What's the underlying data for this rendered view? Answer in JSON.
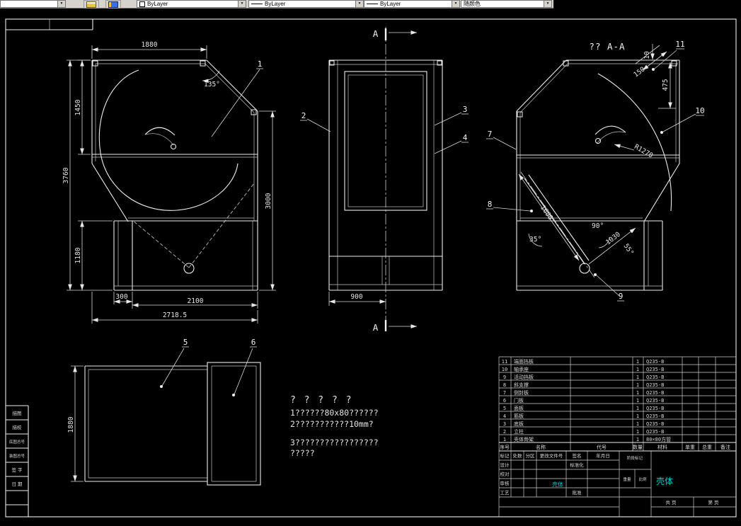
{
  "colors": {
    "background": "#000000",
    "line": "#ececec",
    "accent_cyan": "#00c8c8",
    "toolbar_bg": "#d6d3ce"
  },
  "toolbar": {
    "bylayer1": "ByLayer",
    "bylayer2": "ByLayer",
    "bylayer3": "ByLayer",
    "color_combo": "随颜色"
  },
  "sheet": {
    "left_strip": [
      "描图",
      "描校",
      "底图总号",
      "装图总号",
      "签 字",
      "日 期"
    ]
  },
  "plan": {
    "dim_top": "1880",
    "dim_h1": "1450",
    "dim_h_total": "3760",
    "dim_h2": "1180",
    "dim_b1": "300",
    "dim_b2": "2100",
    "dim_b3": "2718.5",
    "angle": "135°",
    "dim_right": "3000",
    "leader1": "1"
  },
  "front": {
    "dim_bottom": "900",
    "section_a_top": "A",
    "section_a_bottom": "A",
    "leader2": "2",
    "leader3": "3",
    "leader4": "4"
  },
  "section": {
    "title": "?? A-A",
    "dim150": "150",
    "dim10": "10",
    "dim475": "475",
    "radius": "R1270",
    "dim1600": "1600",
    "angle90": "90°",
    "dim1030": "1030",
    "angle35": "35°",
    "angle55": "55°",
    "leader7": "7",
    "leader8": "8",
    "leader9": "9",
    "leader10": "10",
    "leader11": "11"
  },
  "bottom_view": {
    "dim_left": "1880",
    "leader5": "5",
    "leader6": "6"
  },
  "notes": {
    "title": "? ? ? ? ?",
    "line1": "1??????80x80??????",
    "line2": "2???????????10mm?",
    "line3": "3?????????????????",
    "line4": "?????"
  },
  "bom": {
    "header": {
      "c1": "序号",
      "c2": "名称",
      "c3": "代号",
      "c4": "数量",
      "c5": "材料",
      "c6": "单重",
      "c7": "总重",
      "c8": "备注"
    },
    "rows": [
      {
        "no": "11",
        "name": "端面挡板",
        "qty": "1",
        "mat": "Q235-B"
      },
      {
        "no": "10",
        "name": "轴承座",
        "qty": "1",
        "mat": "Q235-B"
      },
      {
        "no": "9",
        "name": "活动挡板",
        "qty": "1",
        "mat": "Q235-B"
      },
      {
        "no": "8",
        "name": "斜支撑",
        "qty": "1",
        "mat": "Q235-B"
      },
      {
        "no": "7",
        "name": "侧封板",
        "qty": "1",
        "mat": "Q235-B"
      },
      {
        "no": "6",
        "name": "门板",
        "qty": "1",
        "mat": "Q235-B"
      },
      {
        "no": "5",
        "name": "面板",
        "qty": "1",
        "mat": "Q235-B"
      },
      {
        "no": "4",
        "name": "筋板",
        "qty": "1",
        "mat": "Q235-B"
      },
      {
        "no": "3",
        "name": "底板",
        "qty": "1",
        "mat": "Q235-B"
      },
      {
        "no": "2",
        "name": "立柱",
        "qty": "1",
        "mat": "Q235-B"
      },
      {
        "no": "1",
        "name": "壳体骨架",
        "qty": "1",
        "mat": "80×80方管"
      }
    ]
  },
  "titleblock": {
    "r1": [
      "标记",
      "处数",
      "分区",
      "更改文件号",
      "签名",
      "年月日"
    ],
    "design": "设计",
    "standard": "标准化",
    "check": "校对",
    "audit": "审核",
    "craft": "工艺",
    "approve": "批准",
    "stage": "阶段标记",
    "weight": "重量",
    "scale": "比例",
    "total": "共 页",
    "page": "第 页",
    "part_name": "壳体",
    "code_text": "壳体"
  }
}
